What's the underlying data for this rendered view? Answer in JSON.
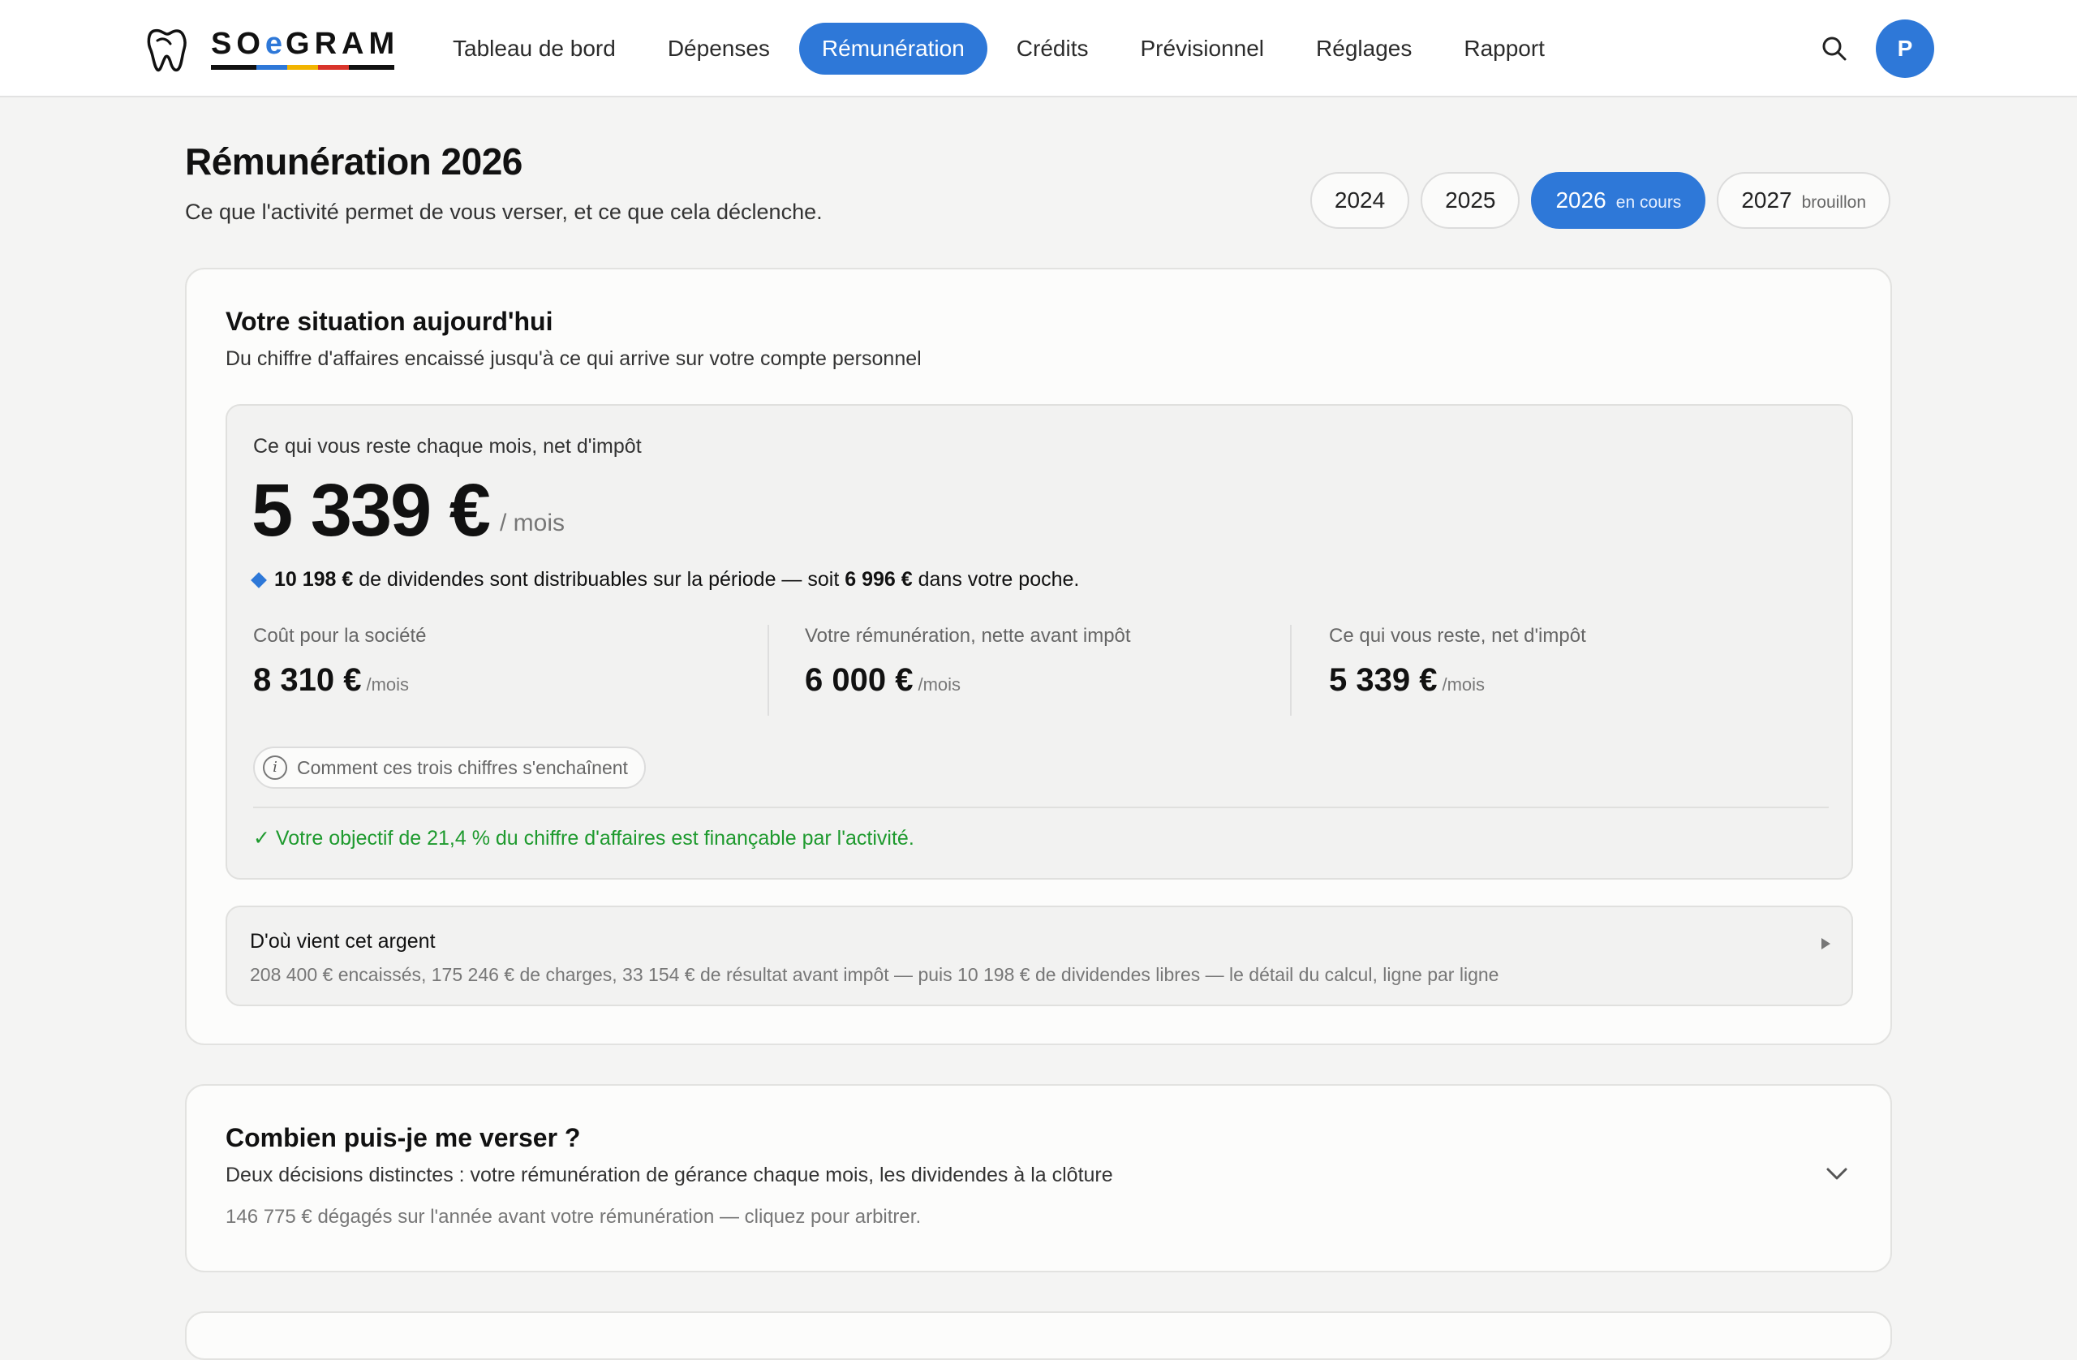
{
  "app": {
    "logo_text_before": "SO",
    "logo_text_e": "e",
    "logo_text_after": "GRAM",
    "logo_bar_colors": [
      "#111111",
      "#2e78d8",
      "#f2b400",
      "#d9342b",
      "#111111"
    ]
  },
  "nav": {
    "items": [
      {
        "label": "Tableau de bord"
      },
      {
        "label": "Dépenses"
      },
      {
        "label": "Rémunération",
        "active": true
      },
      {
        "label": "Crédits"
      },
      {
        "label": "Prévisionnel"
      },
      {
        "label": "Réglages"
      },
      {
        "label": "Rapport"
      }
    ],
    "avatar_initial": "P"
  },
  "page": {
    "title": "Rémunération 2026",
    "subtitle": "Ce que l'activité permet de vous verser, et ce que cela déclenche."
  },
  "years": [
    {
      "year": "2024",
      "tag": ""
    },
    {
      "year": "2025",
      "tag": ""
    },
    {
      "year": "2026",
      "tag": "en cours",
      "active": true
    },
    {
      "year": "2027",
      "tag": "brouillon"
    }
  ],
  "situation": {
    "title": "Votre situation aujourd'hui",
    "subtitle": "Du chiffre d'affaires encaissé jusqu'à ce qui arrive sur votre compte personnel",
    "main_label": "Ce qui vous reste chaque mois, net d'impôt",
    "main_value": "5 339 €",
    "main_unit": "/ mois",
    "dividends": {
      "amount": "10 198 €",
      "text_mid": " de dividendes sont distribuables sur la période — soit ",
      "pocket": "6 996 €",
      "text_end": " dans votre poche."
    },
    "stats": [
      {
        "label": "Coût pour la société",
        "value": "8 310 €",
        "unit": "/mois"
      },
      {
        "label": "Votre rémunération, nette avant impôt",
        "value": "6 000 €",
        "unit": "/mois"
      },
      {
        "label": "Ce qui vous reste, net d'impôt",
        "value": "5 339 €",
        "unit": "/mois"
      }
    ],
    "explain_label": "Comment ces trois chiffres s'enchaînent",
    "objective_text": "✓ Votre objectif de 21,4 % du chiffre d'affaires est finançable par l'activité.",
    "source": {
      "title": "D'où vient cet argent",
      "description": "208 400 € encaissés, 175 246 € de charges, 33 154 € de résultat avant impôt — puis 10 198 € de dividendes libres — le détail du calcul, ligne par ligne"
    }
  },
  "payout": {
    "title": "Combien puis-je me verser ?",
    "subtitle": "Deux décisions distinctes : votre rémunération de gérance chaque mois, les dividendes à la clôture",
    "note": "146 775 € dégagés sur l'année avant votre rémunération — cliquez pour arbitrer."
  },
  "colors": {
    "accent": "#2e78d8",
    "success": "#1e9a2e"
  }
}
